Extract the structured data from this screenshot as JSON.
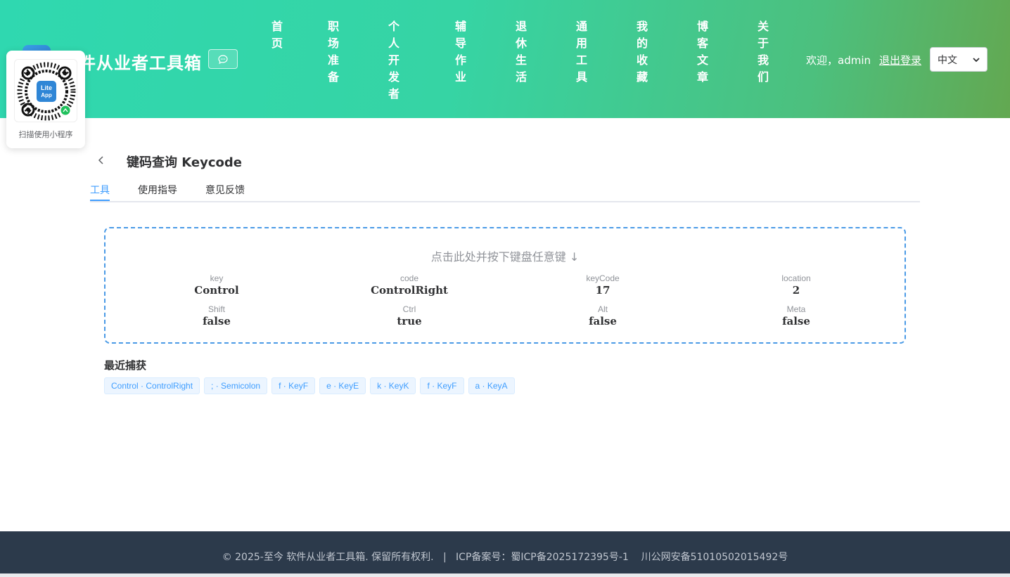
{
  "header": {
    "site_title": "件从业者工具箱",
    "nav": [
      {
        "id": "home",
        "label": "首页"
      },
      {
        "id": "career",
        "label": "职场准备"
      },
      {
        "id": "dev",
        "label": "个人开发者"
      },
      {
        "id": "homework",
        "label": "辅导作业"
      },
      {
        "id": "retire",
        "label": "退休生活"
      },
      {
        "id": "tools",
        "label": "通用工具"
      },
      {
        "id": "favorites",
        "label": "我的收藏"
      },
      {
        "id": "blog",
        "label": "博客文章"
      },
      {
        "id": "about",
        "label": "关于我们"
      }
    ],
    "welcome": "欢迎，admin",
    "logout": "退出登录",
    "language": "中文"
  },
  "qr_card": {
    "logo_line1": "Lite",
    "logo_line2": "App",
    "caption": "扫描使用小程序"
  },
  "page": {
    "title": "键码查询 Keycode",
    "tabs": [
      {
        "label": "工具",
        "active": true
      },
      {
        "label": "使用指导",
        "active": false
      },
      {
        "label": "意见反馈",
        "active": false
      }
    ],
    "hint": "点击此处并按下键盘任意键 ↓",
    "fields": [
      {
        "label": "key",
        "value": "Control"
      },
      {
        "label": "code",
        "value": "ControlRight"
      },
      {
        "label": "keyCode",
        "value": "17"
      },
      {
        "label": "location",
        "value": "2"
      },
      {
        "label": "Shift",
        "value": "false"
      },
      {
        "label": "Ctrl",
        "value": "true"
      },
      {
        "label": "Alt",
        "value": "false"
      },
      {
        "label": "Meta",
        "value": "false"
      }
    ],
    "recent_title": "最近捕获",
    "recent": [
      "Control · ControlRight",
      "; · Semicolon",
      "f · KeyF",
      "e · KeyE",
      "k · KeyK",
      "f · KeyF",
      "a · KeyA"
    ]
  },
  "footer": {
    "text": "© 2025-至今 软件从业者工具箱. 保留所有权利.   |   ICP备案号：蜀ICP备2025172395号-1    川公网安备51010502015492号"
  },
  "colors": {
    "header_start": "#2fd8b0",
    "header_end": "#63a851",
    "accent": "#409eff",
    "footer_bg": "#2c3a4b"
  },
  "icons": {
    "chat": "chat-bubble-icon",
    "back": "chevron-left-icon",
    "caret": "chevron-down-icon"
  }
}
